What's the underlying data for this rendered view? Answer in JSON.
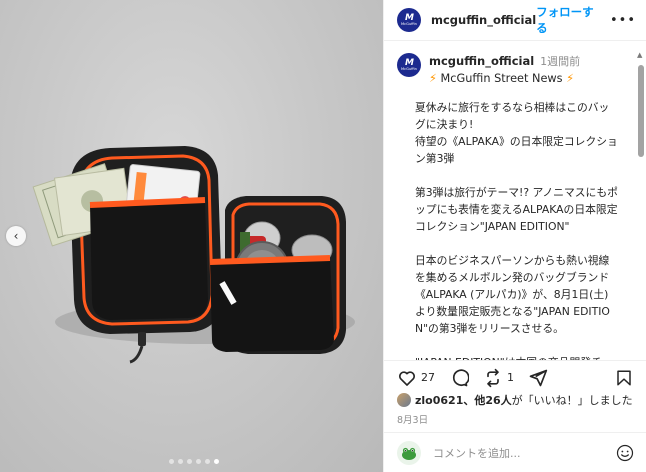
{
  "post": {
    "username": "mcguffin_official",
    "follow_label": "フォローする",
    "more_label": "•••",
    "avatar_text": "M",
    "avatar_subtext": "McGuffin"
  },
  "caption": {
    "username": "mcguffin_official",
    "time": "1週間前",
    "subtitle": "McGuffin Street News",
    "subtitle_icon": "lightning-emoji",
    "text": "夏休みに旅行をするなら相棒はこのバッグに決まり!\n待望の《ALPAKA》の日本限定コレクション第3弾\n\n第3弾は旅行がテーマ!? アノニマスにもポップにも表情を変えるALPAKAの日本限定コレクション\"JAPAN EDITION\"\n\n日本のビジネスパーソンからも熱い視線を集めるメルボルン発のバッグブランド《ALPAKA (アルパカ)》が、8月1日(土)より数量限定販売となる\"JAPAN EDITION\"の第3弾をリリースさせる。\n\n\"JAPAN EDITION\"は本国の商品開発チームと日本の企画チームがタッグを組"
  },
  "actions": {
    "like_count": "27",
    "comment_icon": "comment-icon",
    "repost_count": "1",
    "save_icon": "bookmark-icon"
  },
  "likes": {
    "first_user": "zlo0621",
    "rest": "、他26人",
    "suffix": "が「いいね！」しました"
  },
  "date": "8月3日",
  "comment_box": {
    "placeholder": "コメントを追加...",
    "emoji_icon": "smiley-icon"
  },
  "carousel": {
    "slide_count": 6,
    "active_index": 5
  },
  "colors": {
    "accent": "#0095f6",
    "avatar_bg": "#1c2a8f",
    "bag_orange": "#ff5a1f"
  }
}
